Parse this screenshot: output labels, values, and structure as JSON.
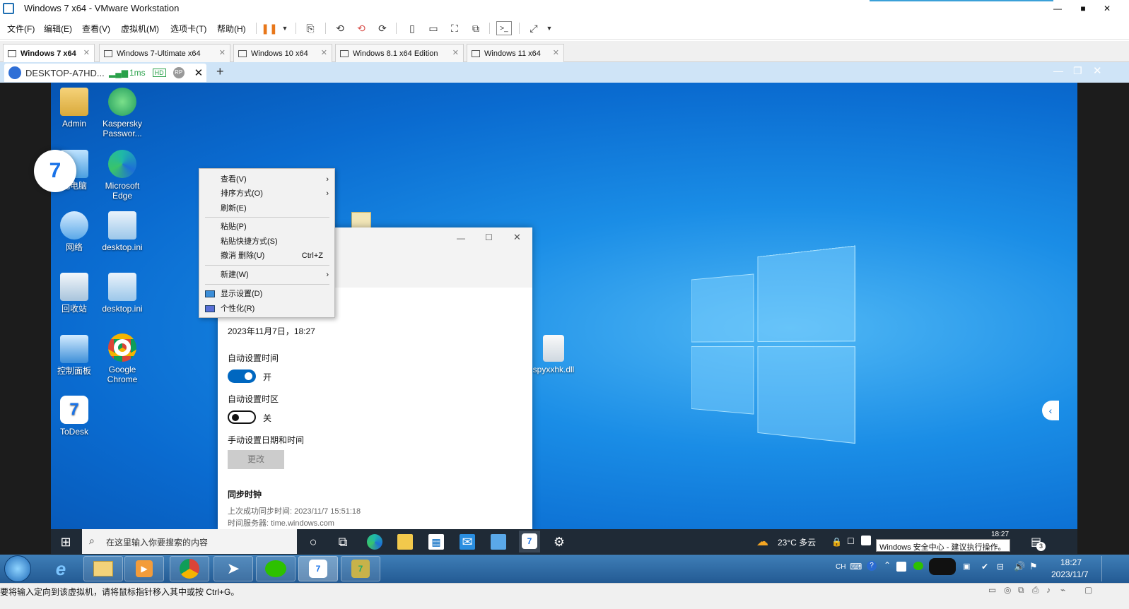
{
  "app": {
    "window_title": "Windows 7 x64 - VMware Workstation",
    "menu": [
      "文件(F)",
      "编辑(E)",
      "查看(V)",
      "虚拟机(M)",
      "选项卡(T)",
      "帮助(H)"
    ],
    "vm_tabs": [
      "Windows 7 x64",
      "Windows 7-Ultimate x64",
      "Windows 10 x64",
      "Windows 8.1 x64 Edition",
      "Windows 11 x64"
    ],
    "active_vm_tab": "Windows 7 x64"
  },
  "todesk": {
    "tab_label": "DESKTOP-A7HD...",
    "latency": "1ms",
    "hd_badge": "HD",
    "rp_badge": "RP",
    "add_tab": "+"
  },
  "desktop_icons": [
    {
      "label": "Admin",
      "icon": "user-folder-icon"
    },
    {
      "label": "Kaspersky Passwor...",
      "icon": "kaspersky-icon"
    },
    {
      "label": "此电脑",
      "icon": "computer-icon"
    },
    {
      "label": "Microsoft Edge",
      "icon": "edge-icon"
    },
    {
      "label": "网络",
      "icon": "network-icon"
    },
    {
      "label": "desktop.ini",
      "icon": "settings-file-icon"
    },
    {
      "label": "回收站",
      "icon": "recycle-bin-icon"
    },
    {
      "label": "desktop.ini",
      "icon": "settings-file-icon"
    },
    {
      "label": "控制面板",
      "icon": "control-panel-icon"
    },
    {
      "label": "Google Chrome",
      "icon": "chrome-icon"
    },
    {
      "label": "ToDesk",
      "icon": "todesk-icon"
    },
    {
      "label": "spyxxhk.dll",
      "icon": "dll-file-icon"
    }
  ],
  "context_menu": {
    "items": [
      {
        "label": "查看(V)",
        "submenu": true
      },
      {
        "label": "排序方式(O)",
        "submenu": true
      },
      {
        "label": "刷新(E)"
      },
      {
        "label": "粘贴(P)"
      },
      {
        "label": "粘贴快捷方式(S)"
      },
      {
        "label": "撤消 删除(U)",
        "shortcut": "Ctrl+Z"
      },
      {
        "label": "新建(W)",
        "submenu": true
      },
      {
        "label": "显示设置(D)"
      },
      {
        "label": "个性化(R)"
      }
    ]
  },
  "settings_window": {
    "datetime": "2023年11月7日，18:27",
    "auto_time_label": "自动设置时间",
    "auto_time_state": "开",
    "auto_zone_label": "自动设置时区",
    "auto_zone_state": "关",
    "manual_label": "手动设置日期和时间",
    "change_button": "更改",
    "sync_label": "同步时钟",
    "last_sync": "上次成功同步时间: 2023/11/7 15:51:18",
    "time_server": "时间服务器: time.windows.com"
  },
  "win10_taskbar": {
    "search_placeholder": "在这里输入你要搜索的内容",
    "weather": "23°C  多云",
    "clock_time": "18:27",
    "notification": "Windows 安全中心 - 建议执行操作。",
    "badge_count": "3"
  },
  "win7_taskbar": {
    "ime": "CH",
    "clock_time": "18:27",
    "clock_date": "2023/11/7"
  },
  "status_bar": {
    "text": "要将输入定向到该虚拟机，请将鼠标指针移入其中或按 Ctrl+G。"
  },
  "colors": {
    "accent": "#0067c0",
    "desktop_blue": "#0a6bd0",
    "win7_taskbar": "#2d6aa5",
    "todesk_bar": "#cfe4f7"
  }
}
